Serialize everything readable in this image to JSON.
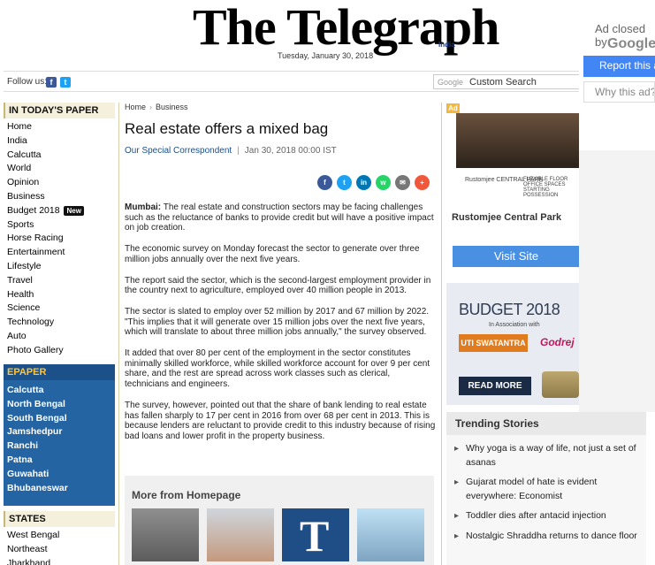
{
  "masthead": {
    "logo": "The Telegraph",
    "logo_sub": "India",
    "date": "Tuesday, January 30, 2018"
  },
  "followbar": {
    "follow_label": "Follow us:",
    "facebook_glyph": "f",
    "twitter_glyph": "t",
    "search_brand": "Google",
    "search_placeholder": "Custom Search"
  },
  "sidebar": {
    "today_head": "IN TODAY'S PAPER",
    "today_items": [
      "Home",
      "India",
      "Calcutta",
      "World",
      "Opinion",
      "Business",
      "Budget 2018",
      "Sports",
      "Horse Racing",
      "Entertainment",
      "Lifestyle",
      "Travel",
      "Health",
      "Science",
      "Technology",
      "Auto",
      "Photo Gallery"
    ],
    "new_badge": "New",
    "epaper_head": "EPAPER",
    "epaper_items": [
      "Calcutta",
      "North Bengal",
      "South Bengal",
      "Jamshedpur",
      "Ranchi",
      "Patna",
      "Guwahati",
      "Bhubaneswar"
    ],
    "states_head": "STATES",
    "states_items": [
      "West Bengal",
      "Northeast",
      "Jharkhand"
    ]
  },
  "article": {
    "breadcrumb": [
      "Home",
      "Business"
    ],
    "title": "Real estate offers a mixed bag",
    "author": "Our Special Correspondent",
    "byline_sep": "|",
    "datetime": "Jan 30, 2018 00:00 IST",
    "share_buttons": [
      {
        "name": "facebook",
        "glyph": "f",
        "color": "#3b5998"
      },
      {
        "name": "twitter",
        "glyph": "t",
        "color": "#1da1f2"
      },
      {
        "name": "linkedin",
        "glyph": "in",
        "color": "#0077b5"
      },
      {
        "name": "whatsapp",
        "glyph": "w",
        "color": "#25d366"
      },
      {
        "name": "email",
        "glyph": "✉",
        "color": "#777777"
      },
      {
        "name": "more",
        "glyph": "+",
        "color": "#f0583c"
      }
    ],
    "lead_dateline": "Mumbai:",
    "paragraphs": [
      " The real estate and construction sectors may be facing challenges such as the reluctance of banks to provide credit but will have a positive impact on job creation.",
      "The economic survey on Monday forecast the sector to generate over three million jobs annually over the next five years.",
      "The report said the sector, which is the second-largest employment provider in the country next to agriculture, employed over 40 million people in 2013.",
      "The sector is slated to employ over 52 million by 2017 and 67 million by 2022. \"This implies that it will generate over 15 million jobs over the next five years, which will translate to about three million jobs annually,\" the survey observed.",
      "It added that over 80 per cent of the employment in the sector constitutes minimally skilled workforce, while skilled workforce account for over 9 per cent share, and the rest are spread across work classes such as clerical, technicians and engineers.",
      "The survey, however, pointed out that the share of bank lending to real estate has fallen sharply to 17 per cent in 2016 from over 68 per cent in 2013. This is because lenders are reluctant to provide credit to this industry because of rising bad loans and lower profit in the property business."
    ],
    "more_title": "More from Homepage",
    "more_thumb_text": "T"
  },
  "right": {
    "ad_label": "Ad",
    "ad_caption_left": "Rustomjee CENTRAL PARK",
    "ad_caption_right": "FLEXIBLE FLOOR OFFICE SPACES STARTING POSSESSION",
    "ad_name": "Rustomjee Central Park",
    "visit_label": "Visit Site",
    "budget_title": "BUDGET 2018",
    "budget_assoc": "In Association with",
    "uti_label": "UTI SWATANTRA",
    "godrej_label": "Godrej",
    "read_more": "READ MORE",
    "trending_head": "Trending Stories",
    "trending": [
      "Why yoga is a way of life, not just a set of asanas",
      "Gujarat model of hate is evident everywhere: Economist",
      "Toddler dies after antacid injection",
      "Nostalgic Shraddha returns to dance floor"
    ]
  },
  "google_ad": {
    "closed": "Ad closed by",
    "brand": "Google",
    "report": "Report this ad",
    "why": "Why this ad?"
  }
}
